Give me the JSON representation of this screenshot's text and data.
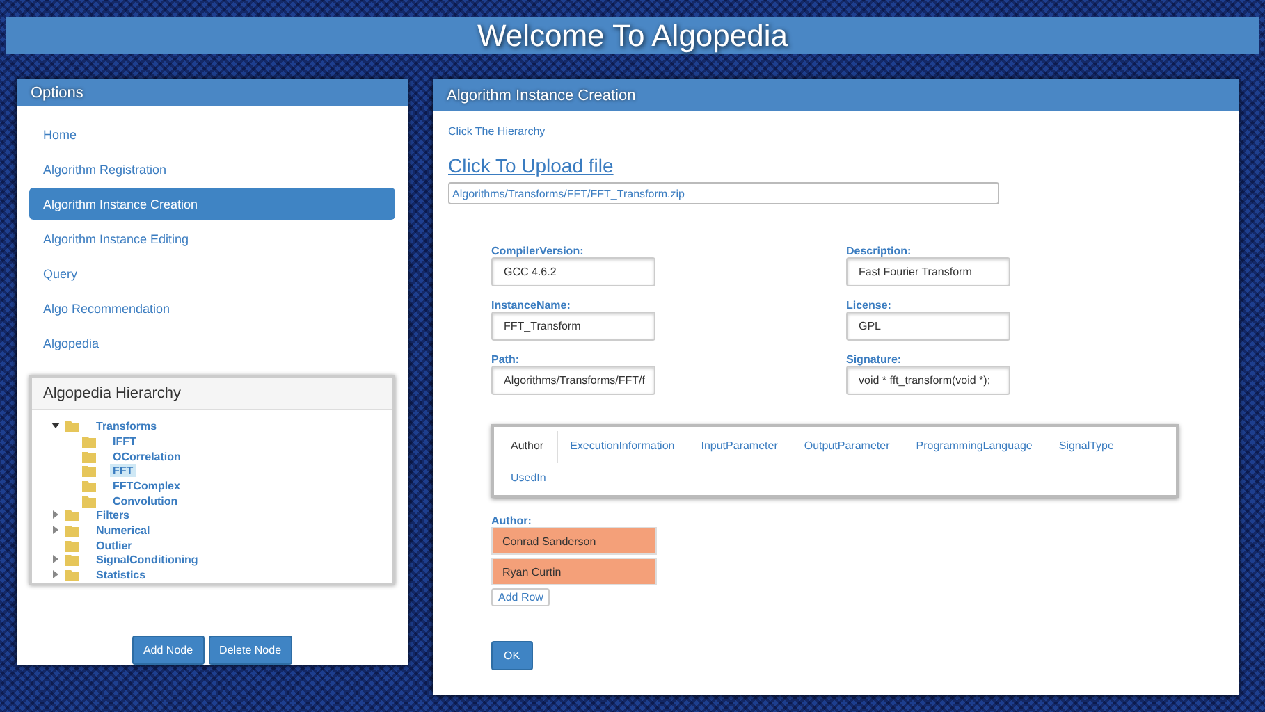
{
  "header": {
    "title": "Welcome To Algopedia"
  },
  "options": {
    "title": "Options",
    "items": [
      {
        "label": "Home",
        "selected": false
      },
      {
        "label": "Algorithm Registration",
        "selected": false
      },
      {
        "label": "Algorithm Instance Creation",
        "selected": true
      },
      {
        "label": "Algorithm Instance Editing",
        "selected": false
      },
      {
        "label": "Query",
        "selected": false
      },
      {
        "label": "Algo Recommendation",
        "selected": false
      },
      {
        "label": "Algopedia",
        "selected": false
      }
    ]
  },
  "hierarchy": {
    "title": "Algopedia Hierarchy",
    "tree": [
      {
        "label": "Transforms",
        "expanded": true,
        "selected": false,
        "children": [
          {
            "label": "IFFT",
            "selected": false
          },
          {
            "label": "OCorrelation",
            "selected": false
          },
          {
            "label": "FFT",
            "selected": true
          },
          {
            "label": "FFTComplex",
            "selected": false
          },
          {
            "label": "Convolution",
            "selected": false
          }
        ]
      },
      {
        "label": "Filters",
        "expanded": false,
        "selected": false
      },
      {
        "label": "Numerical",
        "expanded": false,
        "selected": false
      },
      {
        "label": "Outlier",
        "selected": false
      },
      {
        "label": "SignalConditioning",
        "expanded": false,
        "selected": false
      },
      {
        "label": "Statistics",
        "expanded": false,
        "selected": false
      }
    ]
  },
  "hierarchy_buttons": [
    "Add Node",
    "Delete Node"
  ],
  "creation": {
    "title": "Algorithm Instance Creation",
    "hint_link": "Click The Hierarchy",
    "upload_link": "Click To Upload file",
    "file_path": "Algorithms/Transforms/FFT/FFT_Transform.zip",
    "fields": [
      {
        "label": "CompilerVersion:",
        "value": "GCC 4.6.2"
      },
      {
        "label": "Description:",
        "value": "Fast Fourier Transform"
      },
      {
        "label": "InstanceName:",
        "value": "FFT_Transform"
      },
      {
        "label": "License:",
        "value": "GPL"
      },
      {
        "label": "Path:",
        "value": "Algorithms/Transforms/FFT/f"
      },
      {
        "label": "Signature:",
        "value": "void * fft_transform(void *);"
      }
    ],
    "tabs": [
      {
        "label": "Author",
        "selected": true
      },
      {
        "label": "ExecutionInformation",
        "selected": false
      },
      {
        "label": "InputParameter",
        "selected": false
      },
      {
        "label": "OutputParameter",
        "selected": false
      },
      {
        "label": "ProgrammingLanguage",
        "selected": false
      },
      {
        "label": "SignalType",
        "selected": false
      },
      {
        "label": "UsedIn",
        "selected": false
      }
    ],
    "author_label": "Author:",
    "authors": [
      "Conrad Sanderson",
      "Ryan Curtin"
    ],
    "add_row": "Add Row",
    "ok": "OK"
  }
}
